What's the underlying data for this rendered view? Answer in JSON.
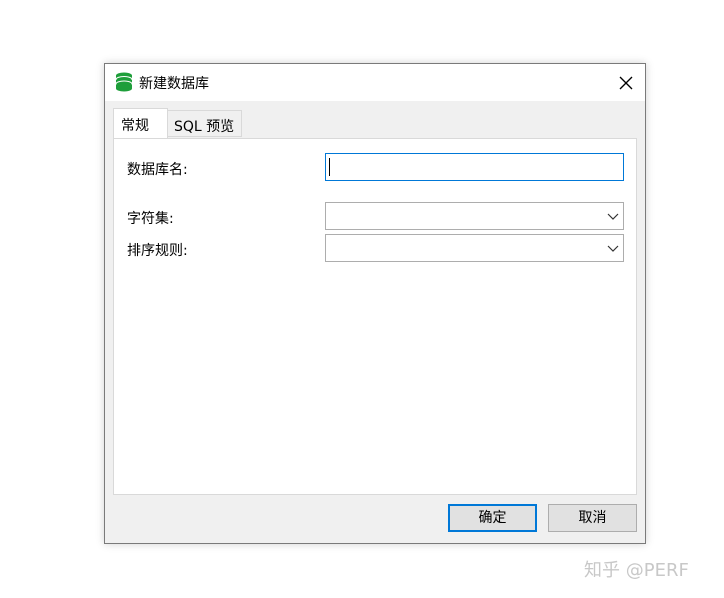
{
  "window": {
    "title": "新建数据库"
  },
  "tabs": [
    {
      "label": "常规",
      "active": true
    },
    {
      "label": "SQL 预览",
      "active": false
    }
  ],
  "form": {
    "database_name": {
      "label": "数据库名:",
      "value": ""
    },
    "charset": {
      "label": "字符集:",
      "value": ""
    },
    "collation": {
      "label": "排序规则:",
      "value": ""
    }
  },
  "buttons": {
    "ok_label": "确定",
    "cancel_label": "取消"
  },
  "watermark": "知乎 @PERF",
  "colors": {
    "accent": "#0078d7",
    "db_icon": "#1e9e3a"
  }
}
